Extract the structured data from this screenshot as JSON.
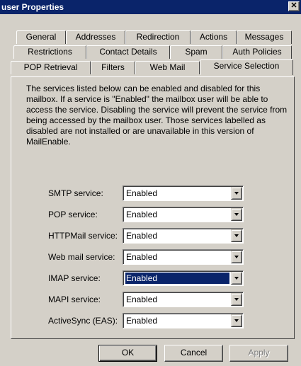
{
  "window": {
    "title": "user Properties",
    "close_glyph": "✕"
  },
  "tabs": {
    "row1": [
      "General",
      "Addresses",
      "Redirection",
      "Actions",
      "Messages"
    ],
    "row2": [
      "Restrictions",
      "Contact Details",
      "Spam",
      "Auth Policies"
    ],
    "row3": [
      "POP Retrieval",
      "Filters",
      "Web Mail",
      "Service Selection"
    ],
    "active": "Service Selection"
  },
  "panel": {
    "description": "The services listed below can be enabled and disabled for this mailbox. If a service is \"Enabled\" the mailbox user will be able to access the service. Disabling the service will prevent the service from being accessed by the mailbox user. Those services labelled as disabled are not installed or are unavailable in this version of MailEnable."
  },
  "services": [
    {
      "label": "SMTP service:",
      "value": "Enabled"
    },
    {
      "label": "POP service:",
      "value": "Enabled"
    },
    {
      "label": "HTTPMail service:",
      "value": "Enabled"
    },
    {
      "label": "Web mail service:",
      "value": "Enabled"
    },
    {
      "label": "IMAP service:",
      "value": "Enabled",
      "focused": true
    },
    {
      "label": "MAPI service:",
      "value": "Enabled"
    },
    {
      "label": "ActiveSync (EAS):",
      "value": "Enabled"
    }
  ],
  "buttons": {
    "ok": "OK",
    "cancel": "Cancel",
    "apply": "Apply"
  },
  "colors": {
    "titlebar": "#0a246a",
    "face": "#d4d0c8",
    "selection": "#0a246a"
  }
}
